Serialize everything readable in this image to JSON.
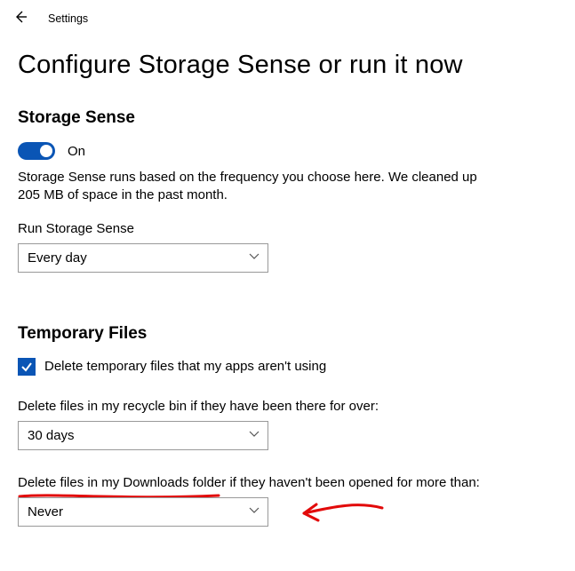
{
  "header": {
    "app_label": "Settings"
  },
  "page": {
    "title": "Configure Storage Sense or run it now"
  },
  "storage_sense": {
    "section_title": "Storage Sense",
    "toggle_label": "On",
    "description": "Storage Sense runs based on the frequency you choose here. We cleaned up 205 MB of space in the past month.",
    "run_label": "Run Storage Sense",
    "run_value": "Every day"
  },
  "temporary_files": {
    "section_title": "Temporary Files",
    "delete_temp_label": "Delete temporary files that my apps aren't using",
    "recycle_label": "Delete files in my recycle bin if they have been there for over:",
    "recycle_value": "30 days",
    "downloads_label": "Delete files in my Downloads folder if they haven't been opened for more than:",
    "downloads_value": "Never"
  },
  "annotations": {
    "underline_color": "#e20a0a",
    "arrow_color": "#e20a0a"
  }
}
